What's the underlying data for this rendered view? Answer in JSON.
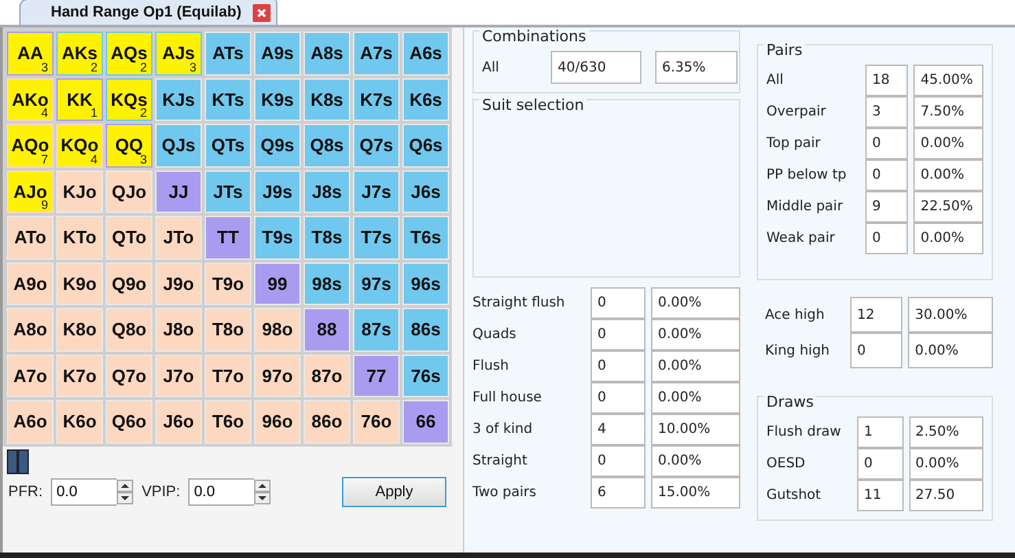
{
  "tab": {
    "title": "Hand Range Op1 (Equilab)",
    "selected": true
  },
  "grid": [
    [
      {
        "label": "AA",
        "kind": "pair",
        "selected": true,
        "count": "3"
      },
      {
        "label": "AKs",
        "kind": "suited",
        "selected": true,
        "count": "2"
      },
      {
        "label": "AQs",
        "kind": "suited",
        "selected": true,
        "count": "2"
      },
      {
        "label": "AJs",
        "kind": "suited",
        "selected": true,
        "count": "3"
      },
      {
        "label": "ATs",
        "kind": "suited",
        "selected": false
      },
      {
        "label": "A9s",
        "kind": "suited",
        "selected": false
      },
      {
        "label": "A8s",
        "kind": "suited",
        "selected": false
      },
      {
        "label": "A7s",
        "kind": "suited",
        "selected": false
      },
      {
        "label": "A6s",
        "kind": "suited",
        "selected": false
      }
    ],
    [
      {
        "label": "AKo",
        "kind": "offsuit",
        "selected": true,
        "count": "4"
      },
      {
        "label": "KK",
        "kind": "pair",
        "selected": true,
        "count": "1"
      },
      {
        "label": "KQs",
        "kind": "suited",
        "selected": true,
        "count": "2"
      },
      {
        "label": "KJs",
        "kind": "suited",
        "selected": false
      },
      {
        "label": "KTs",
        "kind": "suited",
        "selected": false
      },
      {
        "label": "K9s",
        "kind": "suited",
        "selected": false
      },
      {
        "label": "K8s",
        "kind": "suited",
        "selected": false
      },
      {
        "label": "K7s",
        "kind": "suited",
        "selected": false
      },
      {
        "label": "K6s",
        "kind": "suited",
        "selected": false
      }
    ],
    [
      {
        "label": "AQo",
        "kind": "offsuit",
        "selected": true,
        "count": "7"
      },
      {
        "label": "KQo",
        "kind": "offsuit",
        "selected": true,
        "count": "4"
      },
      {
        "label": "QQ",
        "kind": "pair",
        "selected": true,
        "count": "3"
      },
      {
        "label": "QJs",
        "kind": "suited",
        "selected": false
      },
      {
        "label": "QTs",
        "kind": "suited",
        "selected": false
      },
      {
        "label": "Q9s",
        "kind": "suited",
        "selected": false
      },
      {
        "label": "Q8s",
        "kind": "suited",
        "selected": false
      },
      {
        "label": "Q7s",
        "kind": "suited",
        "selected": false
      },
      {
        "label": "Q6s",
        "kind": "suited",
        "selected": false
      }
    ],
    [
      {
        "label": "AJo",
        "kind": "offsuit",
        "selected": true,
        "count": "9"
      },
      {
        "label": "KJo",
        "kind": "offsuit",
        "selected": false
      },
      {
        "label": "QJo",
        "kind": "offsuit",
        "selected": false
      },
      {
        "label": "JJ",
        "kind": "pair",
        "selected": false
      },
      {
        "label": "JTs",
        "kind": "suited",
        "selected": false
      },
      {
        "label": "J9s",
        "kind": "suited",
        "selected": false
      },
      {
        "label": "J8s",
        "kind": "suited",
        "selected": false
      },
      {
        "label": "J7s",
        "kind": "suited",
        "selected": false
      },
      {
        "label": "J6s",
        "kind": "suited",
        "selected": false
      }
    ],
    [
      {
        "label": "ATo",
        "kind": "offsuit",
        "selected": false
      },
      {
        "label": "KTo",
        "kind": "offsuit",
        "selected": false
      },
      {
        "label": "QTo",
        "kind": "offsuit",
        "selected": false
      },
      {
        "label": "JTo",
        "kind": "offsuit",
        "selected": false
      },
      {
        "label": "TT",
        "kind": "pair",
        "selected": false
      },
      {
        "label": "T9s",
        "kind": "suited",
        "selected": false
      },
      {
        "label": "T8s",
        "kind": "suited",
        "selected": false
      },
      {
        "label": "T7s",
        "kind": "suited",
        "selected": false
      },
      {
        "label": "T6s",
        "kind": "suited",
        "selected": false
      }
    ],
    [
      {
        "label": "A9o",
        "kind": "offsuit",
        "selected": false
      },
      {
        "label": "K9o",
        "kind": "offsuit",
        "selected": false
      },
      {
        "label": "Q9o",
        "kind": "offsuit",
        "selected": false
      },
      {
        "label": "J9o",
        "kind": "offsuit",
        "selected": false
      },
      {
        "label": "T9o",
        "kind": "offsuit",
        "selected": false
      },
      {
        "label": "99",
        "kind": "pair",
        "selected": false
      },
      {
        "label": "98s",
        "kind": "suited",
        "selected": false
      },
      {
        "label": "97s",
        "kind": "suited",
        "selected": false
      },
      {
        "label": "96s",
        "kind": "suited",
        "selected": false
      }
    ],
    [
      {
        "label": "A8o",
        "kind": "offsuit",
        "selected": false
      },
      {
        "label": "K8o",
        "kind": "offsuit",
        "selected": false
      },
      {
        "label": "Q8o",
        "kind": "offsuit",
        "selected": false
      },
      {
        "label": "J8o",
        "kind": "offsuit",
        "selected": false
      },
      {
        "label": "T8o",
        "kind": "offsuit",
        "selected": false
      },
      {
        "label": "98o",
        "kind": "offsuit",
        "selected": false
      },
      {
        "label": "88",
        "kind": "pair",
        "selected": false
      },
      {
        "label": "87s",
        "kind": "suited",
        "selected": false
      },
      {
        "label": "86s",
        "kind": "suited",
        "selected": false
      }
    ],
    [
      {
        "label": "A7o",
        "kind": "offsuit",
        "selected": false
      },
      {
        "label": "K7o",
        "kind": "offsuit",
        "selected": false
      },
      {
        "label": "Q7o",
        "kind": "offsuit",
        "selected": false
      },
      {
        "label": "J7o",
        "kind": "offsuit",
        "selected": false
      },
      {
        "label": "T7o",
        "kind": "offsuit",
        "selected": false
      },
      {
        "label": "97o",
        "kind": "offsuit",
        "selected": false
      },
      {
        "label": "87o",
        "kind": "offsuit",
        "selected": false
      },
      {
        "label": "77",
        "kind": "pair",
        "selected": false
      },
      {
        "label": "76s",
        "kind": "suited",
        "selected": false
      }
    ],
    [
      {
        "label": "A6o",
        "kind": "offsuit",
        "selected": false
      },
      {
        "label": "K6o",
        "kind": "offsuit",
        "selected": false
      },
      {
        "label": "Q6o",
        "kind": "offsuit",
        "selected": false
      },
      {
        "label": "J6o",
        "kind": "offsuit",
        "selected": false
      },
      {
        "label": "T6o",
        "kind": "offsuit",
        "selected": false
      },
      {
        "label": "96o",
        "kind": "offsuit",
        "selected": false
      },
      {
        "label": "86o",
        "kind": "offsuit",
        "selected": false
      },
      {
        "label": "76o",
        "kind": "offsuit",
        "selected": false
      },
      {
        "label": "66",
        "kind": "pair",
        "selected": false
      }
    ]
  ],
  "controls": {
    "pfr": {
      "label": "PFR:",
      "value": "0.0"
    },
    "vpip": {
      "label": "VPIP:",
      "value": "0.0"
    },
    "apply": "Apply"
  },
  "combinations": {
    "title": "Combinations",
    "label": "All",
    "count": "40/630",
    "percent": "6.35%"
  },
  "suit_selection": {
    "title": "Suit selection"
  },
  "hands": [
    {
      "label": "Straight flush",
      "count": "0",
      "percent": "0.00%"
    },
    {
      "label": "Quads",
      "count": "0",
      "percent": "0.00%"
    },
    {
      "label": "Flush",
      "count": "0",
      "percent": "0.00%"
    },
    {
      "label": "Full house",
      "count": "0",
      "percent": "0.00%"
    },
    {
      "label": "3 of kind",
      "count": "4",
      "percent": "10.00%"
    },
    {
      "label": "Straight",
      "count": "0",
      "percent": "0.00%"
    },
    {
      "label": "Two pairs",
      "count": "6",
      "percent": "15.00%"
    }
  ],
  "pairs": {
    "title": "Pairs",
    "rows": [
      {
        "label": "All",
        "count": "18",
        "percent": "45.00%"
      },
      {
        "label": "Overpair",
        "count": "3",
        "percent": "7.50%"
      },
      {
        "label": "Top pair",
        "count": "0",
        "percent": "0.00%"
      },
      {
        "label": "PP below tp",
        "count": "0",
        "percent": "0.00%"
      },
      {
        "label": "Middle pair",
        "count": "9",
        "percent": "22.50%"
      },
      {
        "label": "Weak pair",
        "count": "0",
        "percent": "0.00%"
      }
    ]
  },
  "high": [
    {
      "label": "Ace high",
      "count": "12",
      "percent": "30.00%"
    },
    {
      "label": "King high",
      "count": "0",
      "percent": "0.00%"
    }
  ],
  "draws": {
    "title": "Draws",
    "rows": [
      {
        "label": "Flush draw",
        "count": "1",
        "percent": "2.50%"
      },
      {
        "label": "OESD",
        "count": "0",
        "percent": "0.00%"
      },
      {
        "label": "Gutshot",
        "count": "11",
        "percent": "27.50"
      }
    ]
  }
}
